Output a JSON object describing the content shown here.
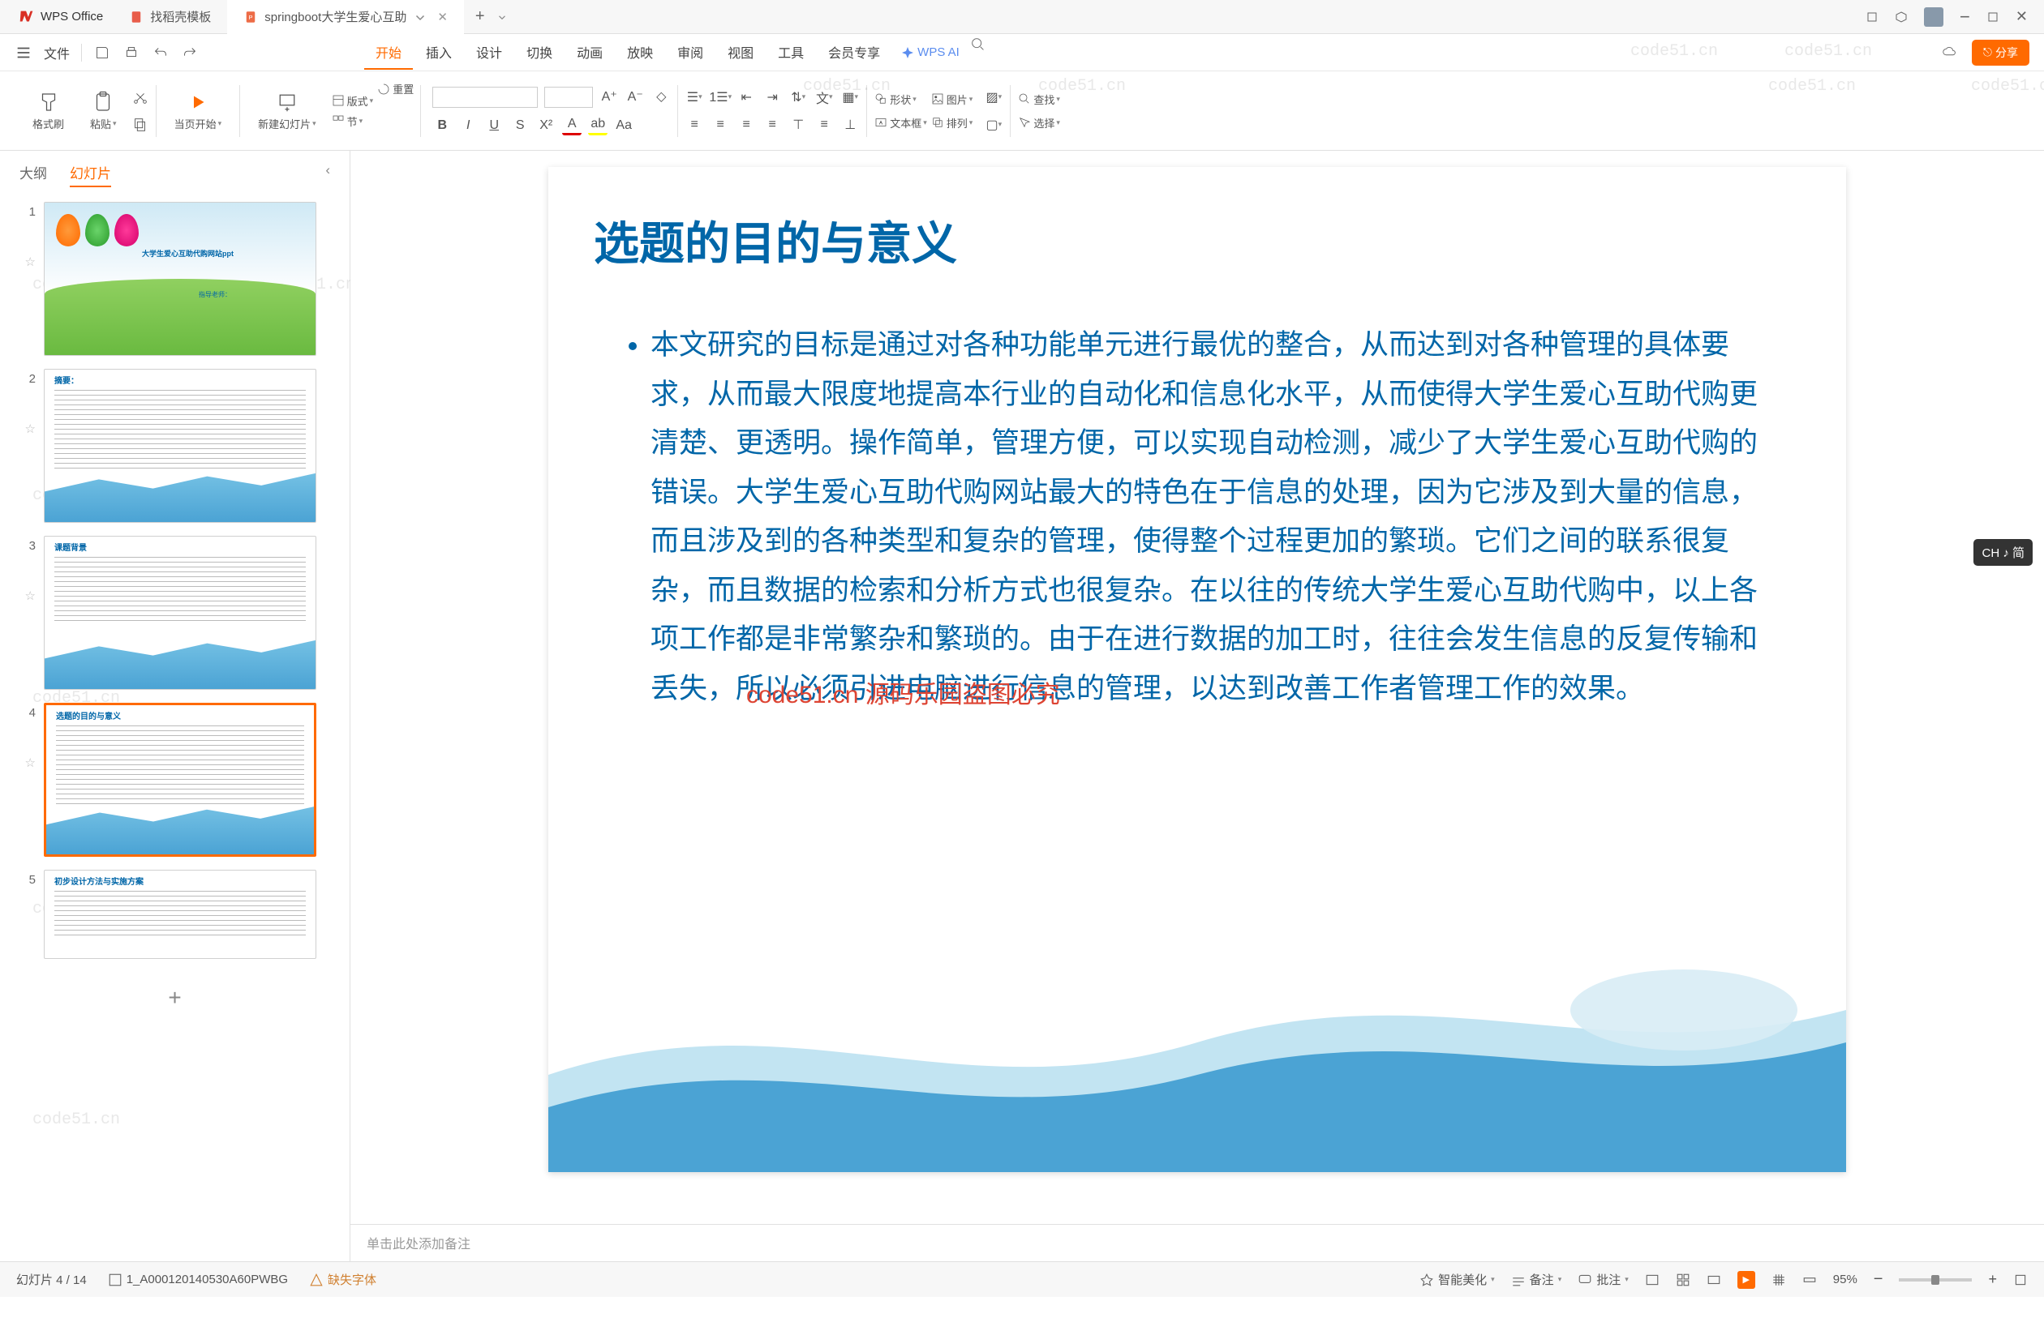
{
  "titlebar": {
    "app_name": "WPS Office",
    "tabs": [
      {
        "label": "找稻壳模板",
        "icon": "doc"
      },
      {
        "label": "springboot大学生爱心互助",
        "icon": "ppt",
        "active": true
      }
    ]
  },
  "menubar": {
    "file": "文件",
    "tabs": [
      "开始",
      "插入",
      "设计",
      "切换",
      "动画",
      "放映",
      "审阅",
      "视图",
      "工具",
      "会员专享"
    ],
    "active_tab": "开始",
    "wps_ai": "WPS AI",
    "share": "分享"
  },
  "ribbon": {
    "format_brush": "格式刷",
    "paste": "粘贴",
    "from_current": "当页开始",
    "new_slide": "新建幻灯片",
    "layout": "版式",
    "section": "节",
    "reset": "重置",
    "shape": "形状",
    "image": "图片",
    "textbox": "文本框",
    "arrange": "排列",
    "find": "查找",
    "select": "选择"
  },
  "sidepanel": {
    "tabs": {
      "outline": "大纲",
      "slides": "幻灯片"
    },
    "thumbs": [
      {
        "n": "1",
        "kind": "cover",
        "title": "大学生爱心互助代购网站ppt",
        "sub": "指导老师："
      },
      {
        "n": "2",
        "kind": "text",
        "title": "摘要："
      },
      {
        "n": "3",
        "kind": "text",
        "title": "课题背景"
      },
      {
        "n": "4",
        "kind": "text",
        "title": "选题的目的与意义",
        "selected": true
      },
      {
        "n": "5",
        "kind": "text",
        "title": "初步设计方法与实施方案"
      }
    ]
  },
  "slide": {
    "title": "选题的目的与意义",
    "body": "本文研究的目标是通过对各种功能单元进行最优的整合，从而达到对各种管理的具体要求，从而最大限度地提高本行业的自动化和信息化水平，从而使得大学生爱心互助代购更清楚、更透明。操作简单，管理方便，可以实现自动检测，减少了大学生爱心互助代购的错误。大学生爱心互助代购网站最大的特色在于信息的处理，因为它涉及到大量的信息，而且涉及到的各种类型和复杂的管理，使得整个过程更加的繁琐。它们之间的联系很复杂，而且数据的检索和分析方式也很复杂。在以往的传统大学生爱心互助代购中，以上各项工作都是非常繁杂和繁琐的。由于在进行数据的加工时，往往会发生信息的反复传输和丢失，所以必须引进电脑进行信息的管理，以达到改善工作者管理工作的效果。"
  },
  "notes": {
    "placeholder": "单击此处添加备注"
  },
  "statusbar": {
    "slide_pos": "幻灯片 4 / 14",
    "file_id": "1_A000120140530A60PWBG",
    "missing_font": "缺失字体",
    "smart_beautify": "智能美化",
    "notes": "备注",
    "comments": "批注",
    "zoom": "95%"
  },
  "watermark": "code51.cn",
  "red_watermark": "code51.cn  源码乐园盗图必究",
  "ime_badge": "CH ♪ 简"
}
